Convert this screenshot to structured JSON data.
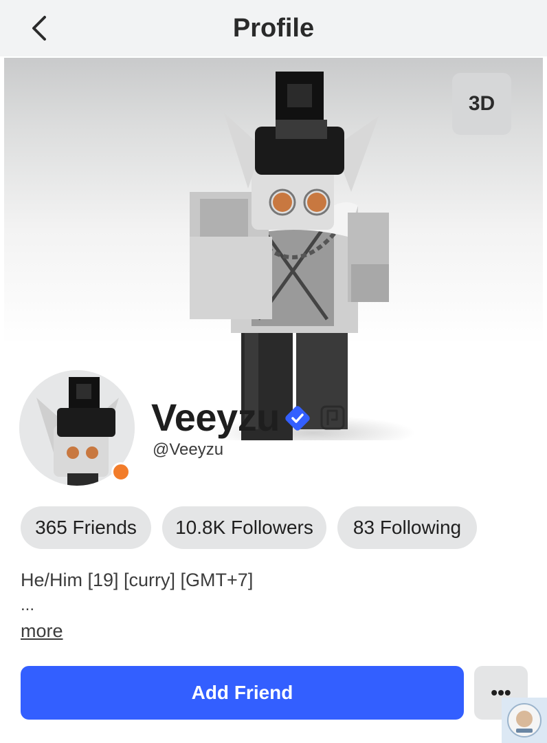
{
  "header": {
    "title": "Profile"
  },
  "stage": {
    "view_toggle_label": "3D"
  },
  "user": {
    "display_name": "Veeyzu",
    "username": "@Veeyzu",
    "presence_color": "#f27c2a"
  },
  "stats": [
    {
      "label": "365 Friends"
    },
    {
      "label": "10.8K Followers"
    },
    {
      "label": "83 Following"
    }
  ],
  "bio": {
    "text": "He/Him [19] [curry] [GMT+7]",
    "ellipsis": "...",
    "more_label": "more"
  },
  "actions": {
    "add_friend_label": "Add Friend",
    "more_options_label": "•••"
  },
  "colors": {
    "primary": "#335fff",
    "verified": "#335fff",
    "pill_bg": "#e4e5e6"
  }
}
